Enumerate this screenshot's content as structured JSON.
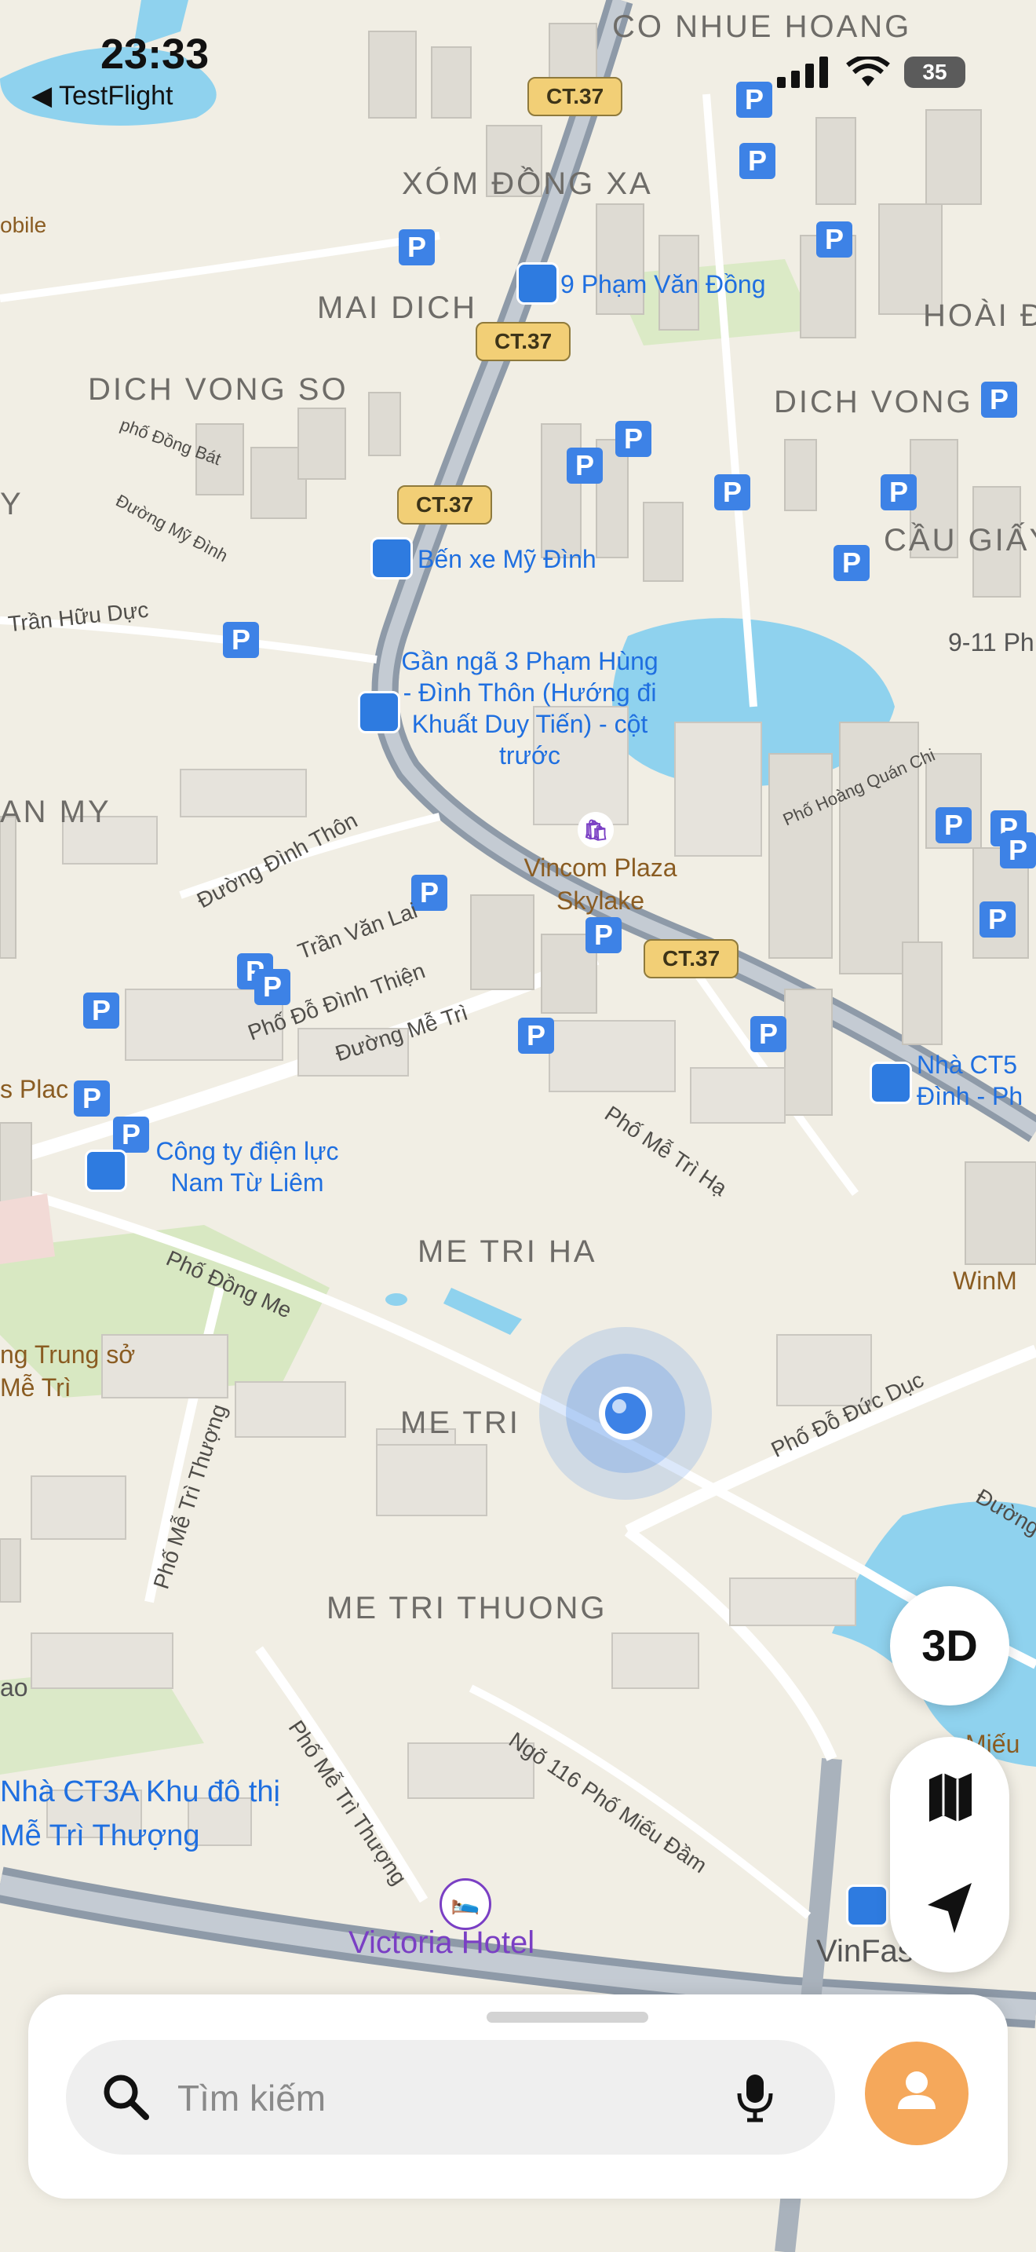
{
  "status_bar": {
    "time": "23:33",
    "back_app": "TestFlight",
    "battery": "35"
  },
  "map": {
    "districts": [
      "CO NHUE HOANG",
      "XÓM ĐỒNG XA",
      "MAI DICH",
      "DICH VONG SO",
      "DICH VONG H",
      "CẦU GIẤY",
      "HOÀI Đ",
      "AN MY",
      "ME TRI HA",
      "ME TRI",
      "ME TRI THUONG",
      "Y"
    ],
    "road_shields": [
      "CT.37",
      "CT.37",
      "CT.37",
      "CT.37"
    ],
    "pois_blue": {
      "bus_pham_van_dong": "9 Phạm Văn Đồng",
      "ben_xe_my_dinh": "Bến xe Mỹ Đình",
      "bus_ga3": "Gần ngã 3 Phạm Hùng - Đình Thôn (Hướng đi Khuất Duy Tiến) - cột trước",
      "cong_ty_dien_luc": "Công ty điện lực Nam Từ Liêm",
      "nha_ct5": "Nhà CT5 Đình - Ph",
      "nha_ct3a": "Nhà CT3A Khu đô thị Mễ Trì Thượng",
      "phi": "9-11 Ph"
    },
    "pois_brown": {
      "vincom": "Vincom Plaza Skylake",
      "winm": "WinM",
      "trung_so": "ng Trung sở Mễ Trì",
      "mieu": "Miếu",
      "vinfast": "VinFast",
      "s_plac": "s Plac",
      "mobile": "obile",
      "ao": "ao"
    },
    "pois_purple": {
      "victoria": "Victoria Hotel"
    },
    "streets": {
      "tran_huu_duc": "Trần Hữu Dực",
      "dinh_thon": "Đường Đình Thôn",
      "tran_van_lai": "Trần Văn Lai",
      "do_dinh_thien": "Phố Đỗ Đình Thiện",
      "me_tri": "Đường Mễ Trì",
      "me_tri_ha": "Phố Mễ Trì Hạ",
      "dong_me": "Phố Đồng Me",
      "do_duc_duc": "Phố Đỗ Đức Dục",
      "me_tri_thuong": "Phố Mễ Trì Thượng",
      "ngo_116": "Ngõ 116 Phố Miếu Đầm",
      "hoang_quan_chi": "Phố Hoàng Quán Chi",
      "duong": "Đường",
      "duong_my_dinh": "Đường Mỹ Đình",
      "pho_dong_bat": "phố Đồng Bát"
    }
  },
  "controls": {
    "three_d_label": "3D"
  },
  "search": {
    "placeholder": "Tìm kiếm"
  },
  "colors": {
    "water": "#8fd2ee",
    "park": "#cfe6b4",
    "road": "#ffffff",
    "expressway": "#8e9aa8",
    "accent_blue": "#3d82e6",
    "avatar": "#f5a85b"
  }
}
